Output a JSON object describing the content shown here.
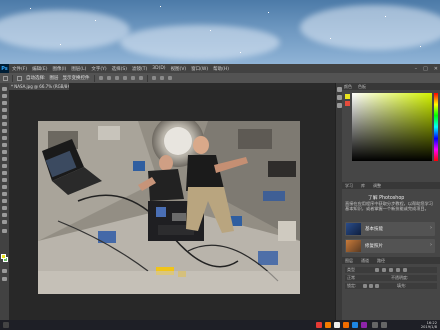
{
  "desktop": {
    "wallpaper": "starry-night-sky"
  },
  "photoshop": {
    "menu": [
      "文件(F)",
      "编辑(E)",
      "图像(I)",
      "图层(L)",
      "文字(Y)",
      "选择(S)",
      "滤镜(T)",
      "3D(D)",
      "视图(V)",
      "窗口(W)",
      "帮助(H)"
    ],
    "options_bar": {
      "auto_select_label": "自动选择:",
      "layer_label": "图层",
      "transform_label": "显示变换控件"
    },
    "document_tab": "* NASA.jpg @ 66.7% (RGB/8#)",
    "panels": {
      "color_tabs": [
        "颜色",
        "色板"
      ],
      "learn_tabs": [
        "学习",
        "库",
        "调整"
      ],
      "learn_title": "了解 Photoshop",
      "learn_desc": "直接在应用程序中获取分步教程，以帮助您学习基本知识，或者掌握一个新技能或完成项目。",
      "learn_cards": [
        "基本技能",
        "修复照片"
      ],
      "layers_tabs": [
        "图层",
        "通道",
        "路径"
      ],
      "layers_filter": "类型",
      "layers_mode": "正常",
      "opacity_label": "不透明度:",
      "lock_label": "锁定:",
      "fill_label": "填充:"
    },
    "colors": {
      "foreground": "#e9e31e",
      "background": "#6cc06a",
      "accent": "#31a8ff"
    }
  },
  "taskbar": {
    "time": "16:22",
    "date": "2019/1/8"
  }
}
